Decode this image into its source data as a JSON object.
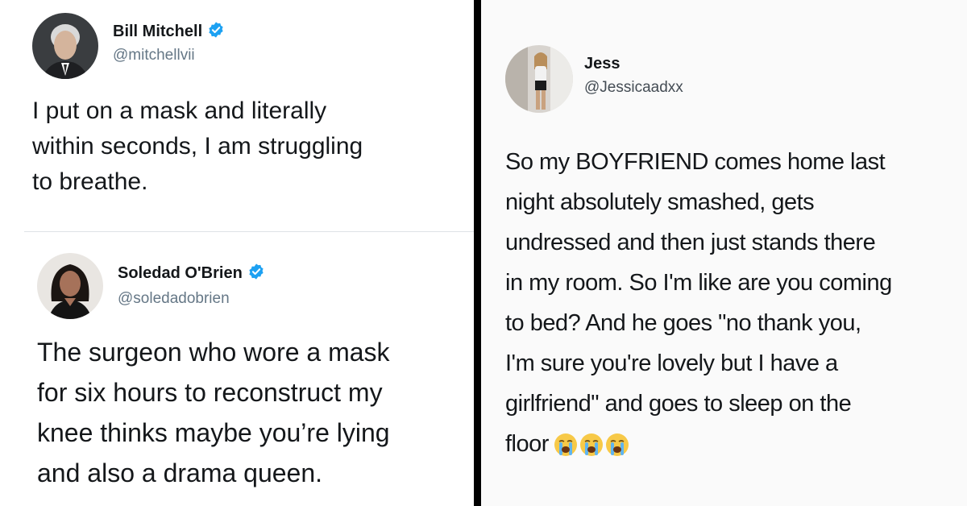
{
  "tweets": [
    {
      "name": "Bill Mitchell",
      "handle": "@mitchellvii",
      "verified": true,
      "text": "I put on a mask and literally\nwithin seconds, I am struggling\nto breathe."
    },
    {
      "name": "Soledad O'Brien",
      "handle": "@soledadobrien",
      "verified": true,
      "text": "The surgeon who wore a mask\nfor six hours to reconstruct my\nknee thinks maybe you’re lying\nand also a drama queen."
    },
    {
      "name": "Jess",
      "handle": "@Jessicaadxx",
      "verified": false,
      "text": "So my BOYFRIEND comes home last\nnight absolutely smashed, gets\nundressed and then just stands there\nin my room. So I'm like are you coming\nto bed? And he goes \"no thank you,\nI'm sure you're lovely but I have a\ngirlfriend\" and goes to sleep on the\nfloor",
      "emojis": [
        "loudly-crying-face-icon",
        "loudly-crying-face-icon",
        "loudly-crying-face-icon"
      ]
    }
  ],
  "colors": {
    "verified": "#1da1f2",
    "handle": "#657786",
    "text": "#14171a",
    "divider": "#000000"
  }
}
